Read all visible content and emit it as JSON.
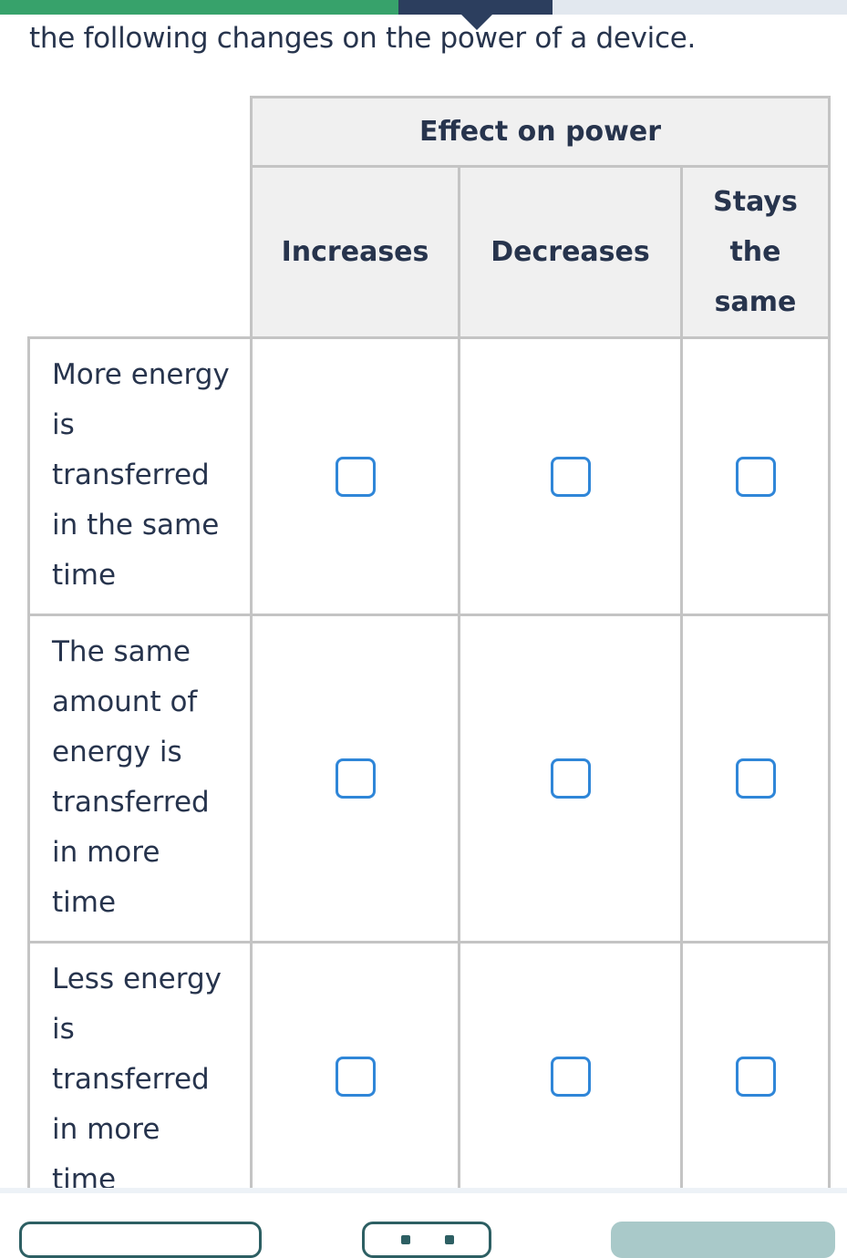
{
  "progress": {
    "segments": [
      {
        "state": "completed",
        "color": "#37a26b"
      },
      {
        "state": "current",
        "color": "#2c3e5e"
      },
      {
        "state": "remaining",
        "color": "#e2e8ef"
      }
    ]
  },
  "prompt": "the following changes on the power of a device.",
  "table": {
    "group_header": "Effect on power",
    "columns": [
      "Increases",
      "Decreases",
      "Stays the same"
    ],
    "rows": [
      {
        "label": "More energy is transferred in the same time",
        "selected": null
      },
      {
        "label": "The same amount of energy is transferred in more time",
        "selected": null
      },
      {
        "label": "Less energy is transferred in more time",
        "selected": null
      }
    ]
  },
  "icons": {
    "checkbox": "checkbox-unchecked-icon"
  },
  "colors": {
    "accent_checkbox": "#2f86d8",
    "text": "#27344d",
    "button_primary_disabled": "#a9c9c9",
    "button_outline": "#2d5f63"
  }
}
